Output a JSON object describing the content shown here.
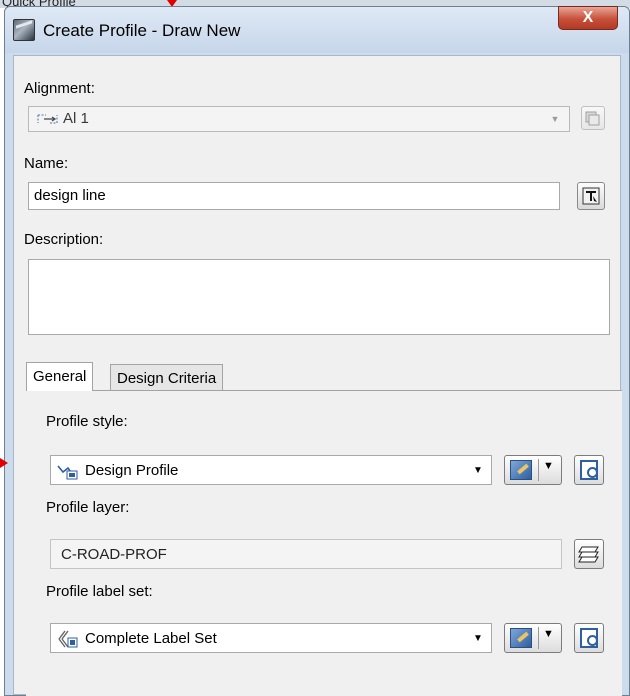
{
  "background": {
    "caption": "Quick Profile"
  },
  "window": {
    "title": "Create Profile - Draw New",
    "close_label": "X"
  },
  "alignment": {
    "label": "Alignment:",
    "value": "Al 1"
  },
  "name": {
    "label": "Name:",
    "value": "design line"
  },
  "description": {
    "label": "Description:",
    "value": ""
  },
  "tabs": [
    {
      "label": "General",
      "active": true
    },
    {
      "label": "Design Criteria",
      "active": false
    }
  ],
  "general": {
    "profile_style": {
      "label": "Profile style:",
      "value": "Design Profile"
    },
    "profile_layer": {
      "label": "Profile layer:",
      "value": "C-ROAD-PROF"
    },
    "profile_label_set": {
      "label": "Profile label set:",
      "value": "Complete Label Set"
    }
  },
  "icons": {
    "alignment": "alignment-icon",
    "pick_alignment": "pick-from-drawing-icon",
    "name_template": "name-template-icon",
    "profile_style": "profile-style-icon",
    "layer": "layer-icon",
    "label_set": "label-set-icon"
  },
  "colors": {
    "title_bar": "#cddcec",
    "close_button": "#c7503a",
    "annotation_arrow": "#e00000"
  }
}
